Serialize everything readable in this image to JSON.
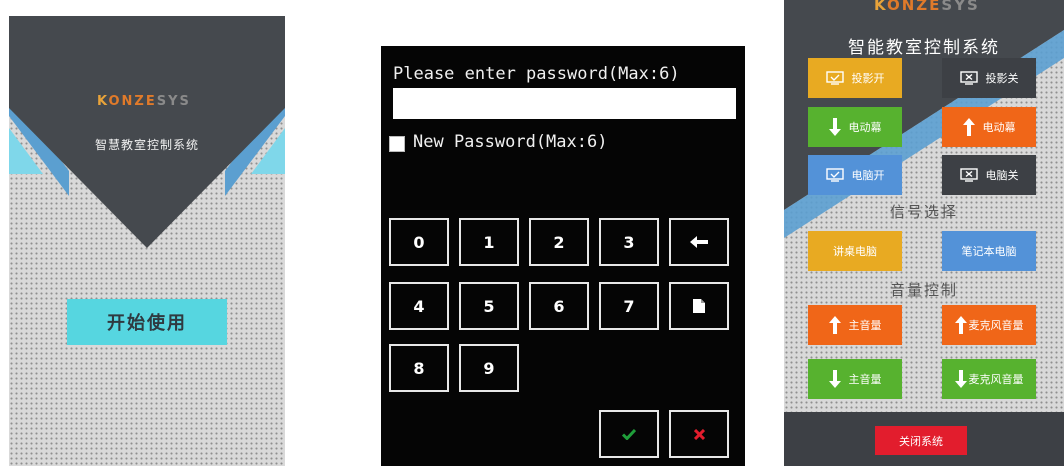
{
  "welcome": {
    "brand": "KONZESYS",
    "title": "智慧教室控制系统",
    "start_label": "开始使用"
  },
  "password": {
    "prompt": "Please enter password(Max:6)",
    "input_value": "",
    "new_password_label": "New Password(Max:6)",
    "keys": [
      "0",
      "1",
      "2",
      "3",
      "4",
      "5",
      "6",
      "7",
      "8",
      "9"
    ],
    "backspace_icon": "left-arrow-icon",
    "file_icon": "file-icon",
    "confirm_icon": "check-icon",
    "cancel_icon": "x-icon",
    "colors": {
      "confirm": "#1f9e3a",
      "cancel": "#e21d2d"
    }
  },
  "control": {
    "brand": "KONZESYS",
    "title": "智能教室控制系统",
    "projector_on": "投影开",
    "projector_off": "投影关",
    "screen_down": "电动幕",
    "screen_up": "电动幕",
    "pc_on": "电脑开",
    "pc_off": "电脑关",
    "signal_label": "信号选择",
    "podium_pc": "讲桌电脑",
    "laptop": "笔记本电脑",
    "volume_label": "音量控制",
    "main_vol_up": "主音量",
    "mic_vol_up": "麦克风音量",
    "main_vol_down": "主音量",
    "mic_vol_down": "麦克风音量",
    "close_system": "关闭系统",
    "colors": {
      "yellow": "#e8aa22",
      "dark": "#3d4045",
      "green": "#57b22f",
      "orange": "#f06618",
      "blue": "#5392d8",
      "red": "#e21d2d"
    }
  }
}
